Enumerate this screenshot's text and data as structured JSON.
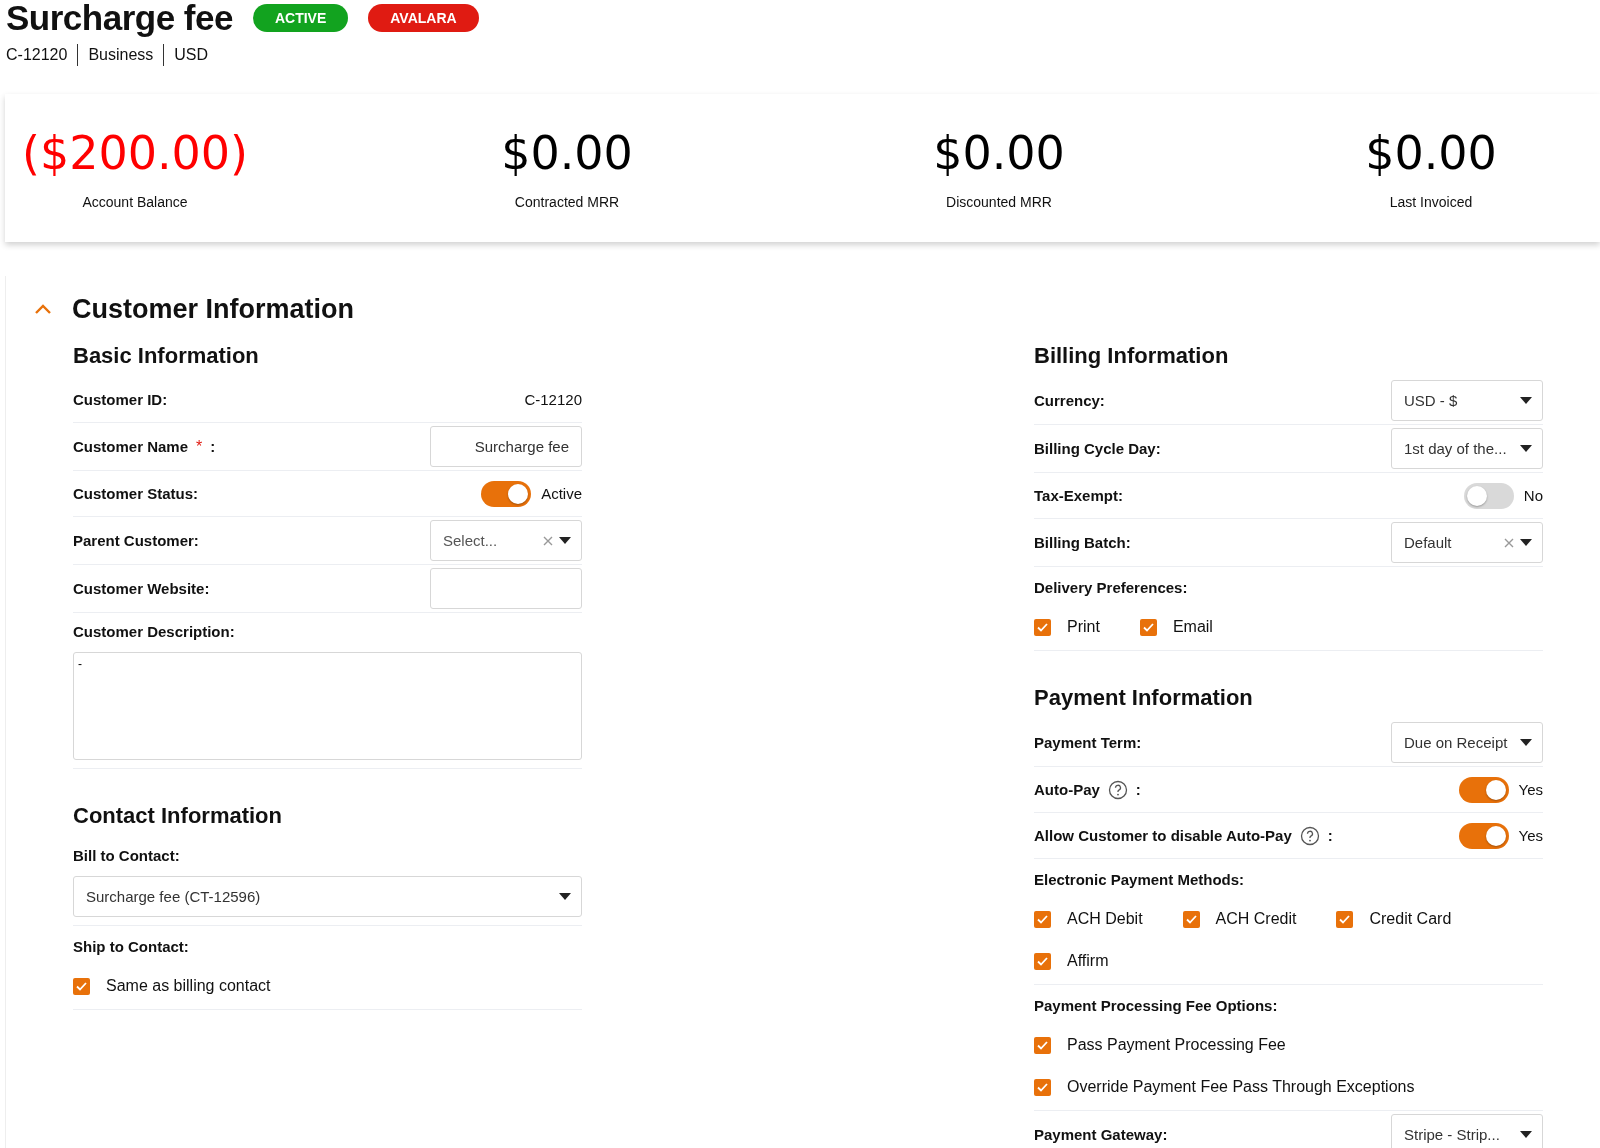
{
  "header": {
    "title": "Surcharge fee",
    "badges": [
      {
        "label": "ACTIVE",
        "color": "#12a31f"
      },
      {
        "label": "AVALARA",
        "color": "#e01b12"
      }
    ],
    "meta": [
      "C-12120",
      "Business",
      "USD"
    ]
  },
  "stats": [
    {
      "value": "($200.00)",
      "label": "Account Balance",
      "negative": true
    },
    {
      "value": "$0.00",
      "label": "Contracted MRR",
      "negative": false
    },
    {
      "value": "$0.00",
      "label": "Discounted MRR",
      "negative": false
    },
    {
      "value": "$0.00",
      "label": "Last Invoiced",
      "negative": false
    }
  ],
  "section": {
    "title": "Customer Information",
    "expanded": true,
    "left": [
      {
        "title": "Basic Information",
        "rows": [
          {
            "kind": "value",
            "label": "Customer ID:",
            "value": "C-12120"
          },
          {
            "kind": "input",
            "label": "Customer Name",
            "required_mark": "*",
            "label_suffix": ":",
            "value": "Surcharge fee"
          },
          {
            "kind": "toggle",
            "label": "Customer Status:",
            "on": true,
            "state_text": "Active"
          },
          {
            "kind": "select",
            "label": "Parent Customer:",
            "placeholder": "Select...",
            "clearable": true
          },
          {
            "kind": "input",
            "label": "Customer Website:"
          },
          {
            "kind": "textarea",
            "label": "Customer Description:",
            "value": "-"
          }
        ]
      },
      {
        "title": "Contact Information",
        "rows": [
          {
            "kind": "stacked_select",
            "label": "Bill to Contact:",
            "value": "Surcharge fee (CT-12596)"
          },
          {
            "kind": "checks",
            "label": "Ship to Contact:",
            "options": [
              {
                "label": "Same as billing contact",
                "checked": true
              }
            ]
          }
        ]
      }
    ],
    "right": [
      {
        "title": "Billing Information",
        "rows": [
          {
            "kind": "select",
            "label": "Currency:",
            "value": "USD - $",
            "clearable": false
          },
          {
            "kind": "select",
            "label": "Billing Cycle Day:",
            "value": "1st day of the...",
            "clearable": false
          },
          {
            "kind": "toggle",
            "label": "Tax-Exempt:",
            "on": false,
            "state_text": "No"
          },
          {
            "kind": "select",
            "label": "Billing Batch:",
            "value": "Default",
            "clearable": true
          },
          {
            "kind": "checks",
            "label": "Delivery Preferences:",
            "options": [
              {
                "label": "Print",
                "checked": true
              },
              {
                "label": "Email",
                "checked": true
              }
            ]
          }
        ]
      },
      {
        "title": "Payment Information",
        "rows": [
          {
            "kind": "select",
            "label": "Payment Term:",
            "value": "Due on Receipt",
            "clearable": false
          },
          {
            "kind": "toggle",
            "label": "Auto-Pay",
            "help": true,
            "label_suffix": ":",
            "on": true,
            "state_text": "Yes"
          },
          {
            "kind": "toggle",
            "label": "Allow Customer to disable Auto-Pay",
            "help": true,
            "label_suffix": ":",
            "on": true,
            "state_text": "Yes"
          },
          {
            "kind": "checks",
            "label": "Electronic Payment Methods:",
            "options": [
              {
                "label": "ACH Debit",
                "checked": true
              },
              {
                "label": "ACH Credit",
                "checked": true
              },
              {
                "label": "Credit Card",
                "checked": true
              },
              {
                "label": "Affirm",
                "checked": true
              }
            ]
          },
          {
            "kind": "checks",
            "label": "Payment Processing Fee Options:",
            "options": [
              {
                "label": "Pass Payment Processing Fee",
                "checked": true
              },
              {
                "label": "Override Payment Fee Pass Through Exceptions",
                "checked": true
              }
            ]
          },
          {
            "kind": "select",
            "label": "Payment Gateway:",
            "value": "Stripe - Strip...",
            "clearable": false
          }
        ]
      }
    ]
  }
}
